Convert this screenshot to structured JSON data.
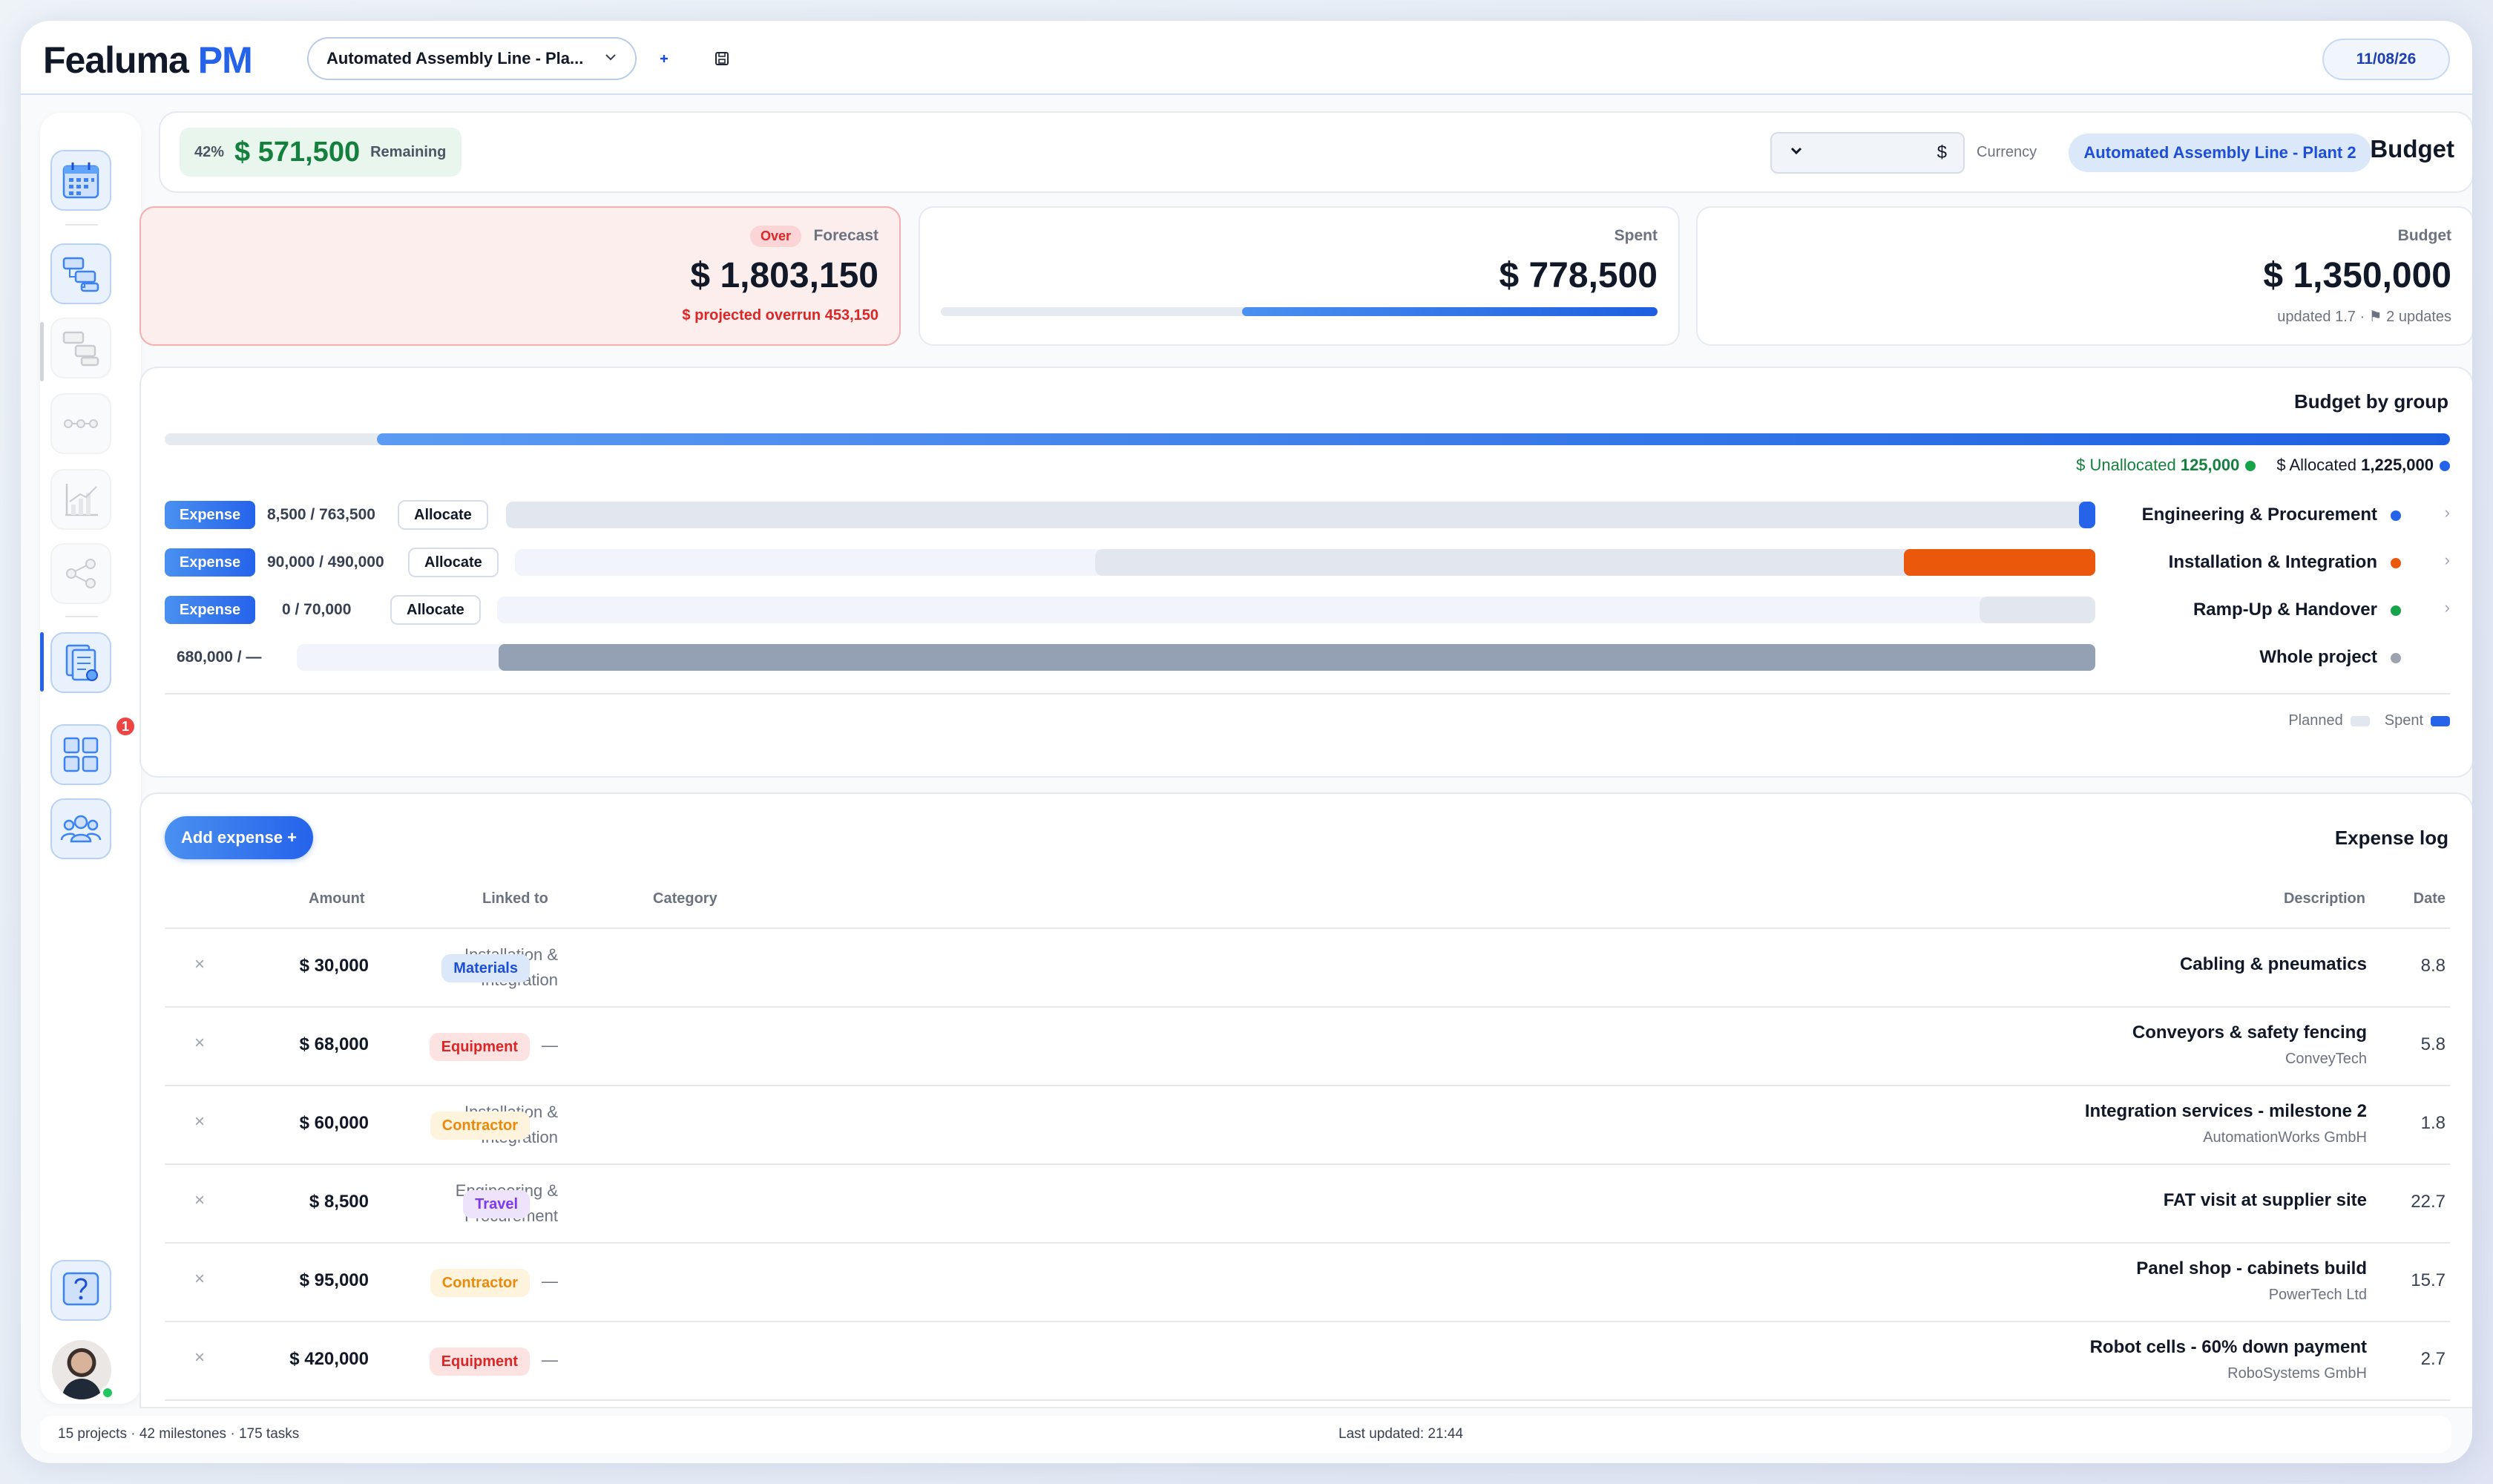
{
  "app": {
    "brand_main": "Fealuma",
    "brand_accent": "PM"
  },
  "topbar": {
    "project_select": "Automated Assembly Line - Pla...",
    "add_icon": "plus-icon",
    "save_icon": "save-icon",
    "date": "11/08/26"
  },
  "sidebar": {
    "items": [
      {
        "icon": "calendar-icon",
        "active": false
      },
      {
        "icon": "gantt-icon",
        "active": false
      },
      {
        "icon": "gantt-alt-icon",
        "active": false
      },
      {
        "icon": "timeline-icon",
        "active": false
      },
      {
        "icon": "chart-icon",
        "active": false
      },
      {
        "icon": "share-icon",
        "active": false
      },
      {
        "icon": "budget-documents-icon",
        "active": true
      },
      {
        "icon": "dashboard-icon",
        "badge": "1"
      },
      {
        "icon": "team-icon"
      }
    ],
    "help_icon": "help-icon"
  },
  "header": {
    "percent": "42%",
    "remaining_amount": "$ 571,500",
    "remaining_label": "Remaining",
    "currency_value": "$",
    "currency_label": "Currency",
    "project_tag": "Automated Assembly Line - Plant 2",
    "title": "Budget"
  },
  "cards": {
    "forecast": {
      "label": "Forecast",
      "badge": "Over",
      "amount": "$ 1,803,150",
      "sub": "$ projected overrun 453,150"
    },
    "spent": {
      "label": "Spent",
      "amount": "$ 778,500",
      "progress": 0.58
    },
    "budget": {
      "label": "Budget",
      "amount": "$ 1,350,000",
      "sub": "updated 1.7 · ⚑ 2 updates"
    }
  },
  "groups": {
    "title": "Budget by group",
    "allocated_fraction": 0.907,
    "unallocated_label": "$ Unallocated",
    "unallocated_value": "125,000",
    "allocated_label": "$ Allocated",
    "allocated_value": "1,225,000",
    "expense_label": "Expense",
    "allocate_label": "Allocate",
    "rows": [
      {
        "name": "Engineering & Procurement",
        "nums": "8,500 / 763,500",
        "color": "#2563eb",
        "spent_color": "#2563eb"
      },
      {
        "name": "Installation & Integration",
        "nums": "90,000 / 490,000",
        "color": "#ea580c",
        "spent_color": "#ea580c"
      },
      {
        "name": "Ramp-Up & Handover",
        "nums": "0 / 70,000",
        "color": "#16a34a",
        "spent_color": "#16a34a"
      },
      {
        "name": "Whole project",
        "nums": "680,000 / —",
        "color": "#9ca3af",
        "spent_color": "#94a0b4"
      }
    ],
    "legend_planned": "Planned",
    "legend_spent": "Spent"
  },
  "log": {
    "add_button": "Add expense +",
    "title": "Expense log",
    "headers": {
      "amount": "Amount",
      "linked": "Linked to",
      "category": "Category",
      "description": "Description",
      "date": "Date"
    },
    "rows": [
      {
        "amount": "$ 30,000",
        "linked": [
          "Installation &",
          "Integration"
        ],
        "category": "Materials",
        "description": "Cabling & pneumatics",
        "vendor": "",
        "date": "8.8"
      },
      {
        "amount": "$ 68,000",
        "linked": [
          "—"
        ],
        "category": "Equipment",
        "description": "Conveyors & safety fencing",
        "vendor": "ConveyTech",
        "date": "5.8"
      },
      {
        "amount": "$ 60,000",
        "linked": [
          "Installation &",
          "Integration"
        ],
        "category": "Contractor",
        "description": "Integration services - milestone 2",
        "vendor": "AutomationWorks GmbH",
        "date": "1.8"
      },
      {
        "amount": "$ 8,500",
        "linked": [
          "Engineering &",
          "Procurement"
        ],
        "category": "Travel",
        "description": "FAT visit at supplier site",
        "vendor": "",
        "date": "22.7"
      },
      {
        "amount": "$ 95,000",
        "linked": [
          "—"
        ],
        "category": "Contractor",
        "description": "Panel shop - cabinets build",
        "vendor": "PowerTech Ltd",
        "date": "15.7"
      },
      {
        "amount": "$ 420,000",
        "linked": [
          "—"
        ],
        "category": "Equipment",
        "description": "Robot cells - 60% down payment",
        "vendor": "RoboSystems GmbH",
        "date": "2.7"
      }
    ],
    "category_colors": {
      "Materials": {
        "bg": "#dbe8fa",
        "fg": "#1d4ed8"
      },
      "Equipment": {
        "bg": "#fde2e2",
        "fg": "#dc2626"
      },
      "Contractor": {
        "bg": "#fef3dc",
        "fg": "#ea8a0c"
      },
      "Travel": {
        "bg": "#ede4fb",
        "fg": "#7c3aed"
      }
    }
  },
  "footer": {
    "stats": "15 projects · 42 milestones · 175 tasks",
    "updated": "Last updated: 21:44"
  }
}
